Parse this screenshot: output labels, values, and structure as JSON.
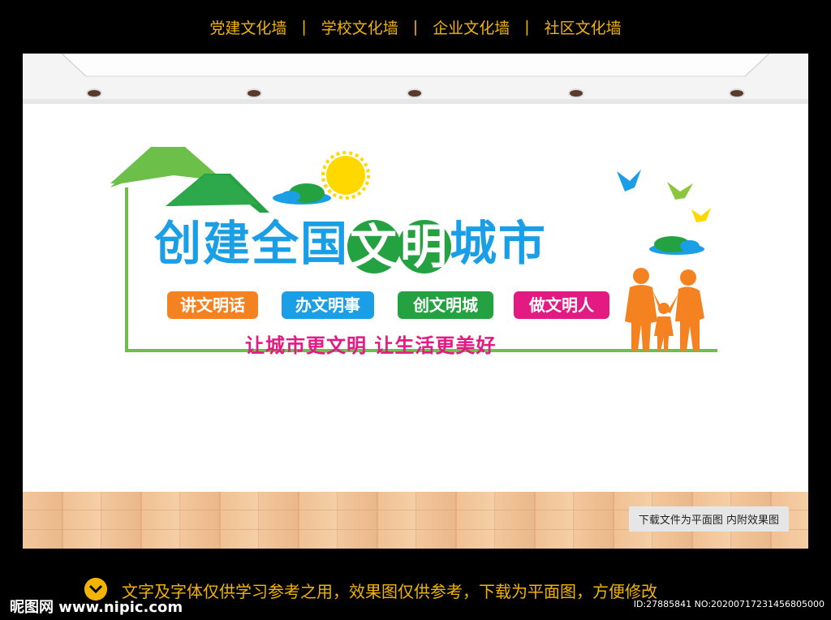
{
  "nav": {
    "items": [
      "党建文化墙",
      "学校文化墙",
      "企业文化墙",
      "社区文化墙"
    ],
    "separator": "|"
  },
  "artwork": {
    "title_part1": "创建全国",
    "title_circle1": "文",
    "title_circle2": "明",
    "title_part2": "城市",
    "pills": [
      {
        "label": "讲文明话",
        "color": "#f58220"
      },
      {
        "label": "办文明事",
        "color": "#1a9ee6"
      },
      {
        "label": "创文明城",
        "color": "#24a140"
      },
      {
        "label": "做文明人",
        "color": "#e21a82"
      }
    ],
    "slogan": "让城市更文明  让生活更美好",
    "colors": {
      "green": "#6cc04a",
      "dark_green": "#24a140",
      "orange": "#f58220",
      "blue": "#1a9ee6",
      "pink": "#e21a82",
      "sun": "#ffd800"
    }
  },
  "scene": {
    "note": "下载文件为平面图  内附效果图"
  },
  "footer": {
    "disclaimer": "文字及字体仅供学习参考之用，效果图仅供参考，下载为平面图，方便修改",
    "logo": "昵图网 www.nipic.com",
    "id_text": "ID:27885841 NO:20200717231456805000",
    "accent": "#f2b400",
    "icon": "chevron-down-icon"
  }
}
